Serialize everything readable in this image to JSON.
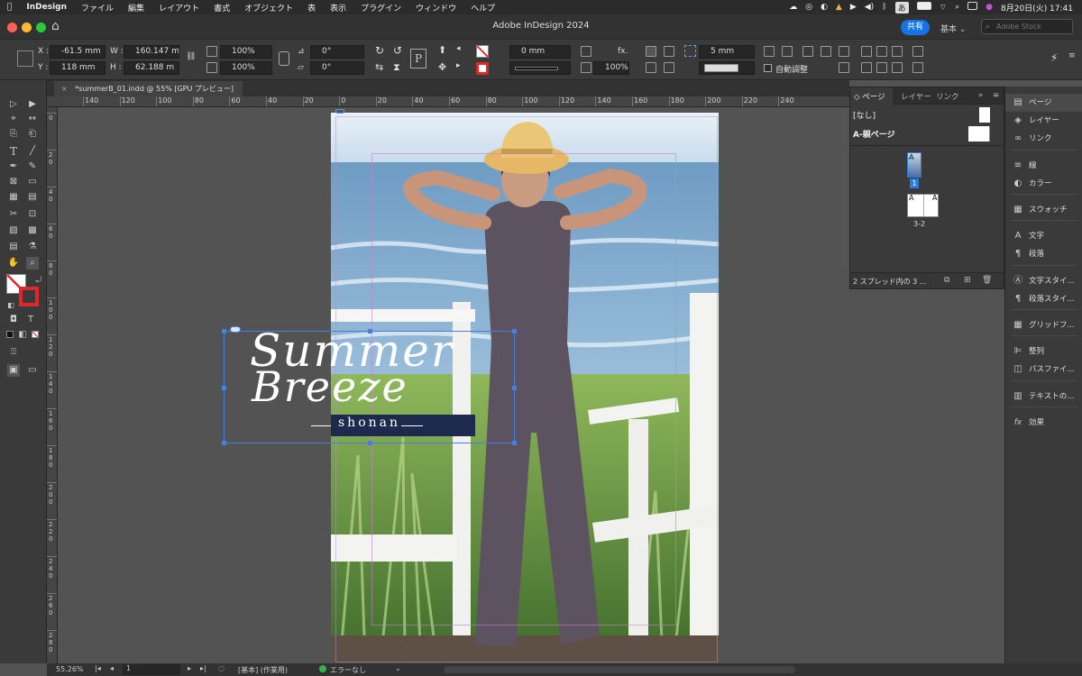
{
  "menubar": {
    "apple": "",
    "app": "InDesign",
    "items": [
      "ファイル",
      "編集",
      "レイアウト",
      "書式",
      "オブジェクト",
      "表",
      "表示",
      "プラグイン",
      "ウィンドウ",
      "ヘルプ"
    ],
    "ime": "あ",
    "datetime": "8月20日(火) 17:41"
  },
  "titlebar": {
    "title": "Adobe InDesign 2024",
    "share": "共有",
    "workspace": "基本",
    "stock_placeholder": "Adobe Stock"
  },
  "control": {
    "x_label": "X :",
    "x": "-61.5 mm",
    "y_label": "Y :",
    "y": "118 mm",
    "w_label": "W :",
    "w": "160.147 m",
    "h_label": "H :",
    "h": "62.188 m",
    "scale_x": "100%",
    "scale_y": "100%",
    "angle": "0°",
    "shear": "0°",
    "stroke_weight": "0 mm",
    "opacity": "100%",
    "fx": "fx.",
    "gap": "5 mm",
    "auto_fit": "自動調整"
  },
  "tab": {
    "label": "*summerB_01.indd @ 55% [GPU プレビュー]"
  },
  "hruler": [
    "140",
    "120",
    "100",
    "80",
    "60",
    "40",
    "20",
    "0",
    "20",
    "40",
    "60",
    "80",
    "100",
    "120",
    "140",
    "160",
    "180",
    "200",
    "220",
    "240"
  ],
  "vruler": [
    "0",
    "2 0",
    "4 0",
    "6 0",
    "8 0",
    "1 0 0",
    "1 2 0",
    "1 4 0",
    "1 6 0",
    "1 8 0",
    "2 0 0",
    "2 2 0",
    "2 4 0",
    "2 6 0",
    "2 8 0"
  ],
  "artwork": {
    "title1": "Summer",
    "title2": "Breeze",
    "subtitle": "shonan"
  },
  "pages_panel": {
    "tabs": [
      "ページ",
      "レイヤー",
      "リンク"
    ],
    "none": "[なし]",
    "master": "A-親ページ",
    "page1_number": "1",
    "master_letter": "A",
    "spread_label": "3-2",
    "footer": "2 スプレッド内の 3 ..."
  },
  "dock": {
    "items": [
      {
        "icon": "pages-icon",
        "label": "ページ"
      },
      {
        "icon": "layers-icon",
        "label": "レイヤー"
      },
      {
        "icon": "links-icon",
        "label": "リンク"
      },
      {
        "icon": "stroke-icon",
        "label": "線"
      },
      {
        "icon": "color-icon",
        "label": "カラー"
      },
      {
        "icon": "swatches-icon",
        "label": "スウォッチ"
      },
      {
        "icon": "character-icon",
        "label": "文字"
      },
      {
        "icon": "paragraph-icon",
        "label": "段落"
      },
      {
        "icon": "character-styles-icon",
        "label": "文字スタイ..."
      },
      {
        "icon": "paragraph-styles-icon",
        "label": "段落スタイ..."
      },
      {
        "icon": "grid-format-icon",
        "label": "グリッドフ..."
      },
      {
        "icon": "align-icon",
        "label": "整列"
      },
      {
        "icon": "pathfinder-icon",
        "label": "パスファイ..."
      },
      {
        "icon": "text-wrap-icon",
        "label": "テキストの..."
      },
      {
        "icon": "effects-icon",
        "label": "効果"
      }
    ]
  },
  "status": {
    "zoom": "55.26%",
    "page": "1",
    "profile": "[基本] (作業用)",
    "errors": "エラーなし"
  },
  "colors": {
    "accent": "#1473e6",
    "error_ok": "#35b34a",
    "selection": "#4a7fd8",
    "banner": "#1d2a4d"
  }
}
